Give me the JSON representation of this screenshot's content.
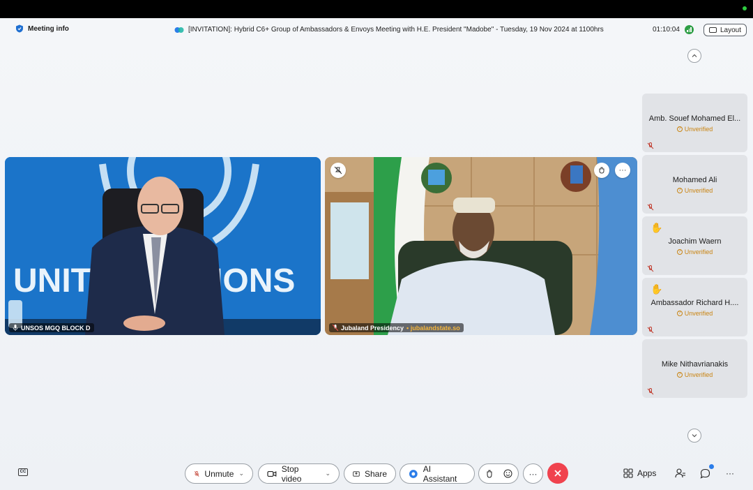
{
  "header": {
    "meeting_info_label": "Meeting info",
    "meeting_title": "[INVITATION]: Hybrid C6+ Group of Ambassadors & Envoys Meeting with H.E. President \"Madobe\" - Tuesday, 19 Nov 2024 at 1100hrs",
    "timer": "01:10:04",
    "layout_label": "Layout"
  },
  "videos": [
    {
      "name": "UNSOS MGQ BLOCK D",
      "subtitle": ""
    },
    {
      "name": "Jubaland Presidency",
      "subtitle": "jubalandstate.so"
    }
  ],
  "video_backdrop_text": "UNITED NATIONS",
  "participants": [
    {
      "name": "Amb. Souef Mohamed El...",
      "status": "Unverified",
      "hand_raised": false
    },
    {
      "name": "Mohamed Ali",
      "status": "Unverified",
      "hand_raised": false
    },
    {
      "name": "Joachim Waern",
      "status": "Unverified",
      "hand_raised": true
    },
    {
      "name": "Ambassador Richard H....",
      "status": "Unverified",
      "hand_raised": true
    },
    {
      "name": "Mike Nithavrianakis",
      "status": "Unverified",
      "hand_raised": false
    }
  ],
  "toolbar": {
    "unmute_label": "Unmute",
    "stop_video_label": "Stop video",
    "share_label": "Share",
    "ai_assistant_label": "AI Assistant",
    "apps_label": "Apps"
  },
  "icons": {
    "meeting_info": "shield-icon",
    "captions": "closed-captions-icon",
    "mic_off": "mic-off-icon",
    "end_call": "close-icon"
  },
  "colors": {
    "end_call": "#f0434e",
    "unverified": "#c98412",
    "signal": "#2e9e45",
    "accent_blue": "#2b7de9"
  }
}
